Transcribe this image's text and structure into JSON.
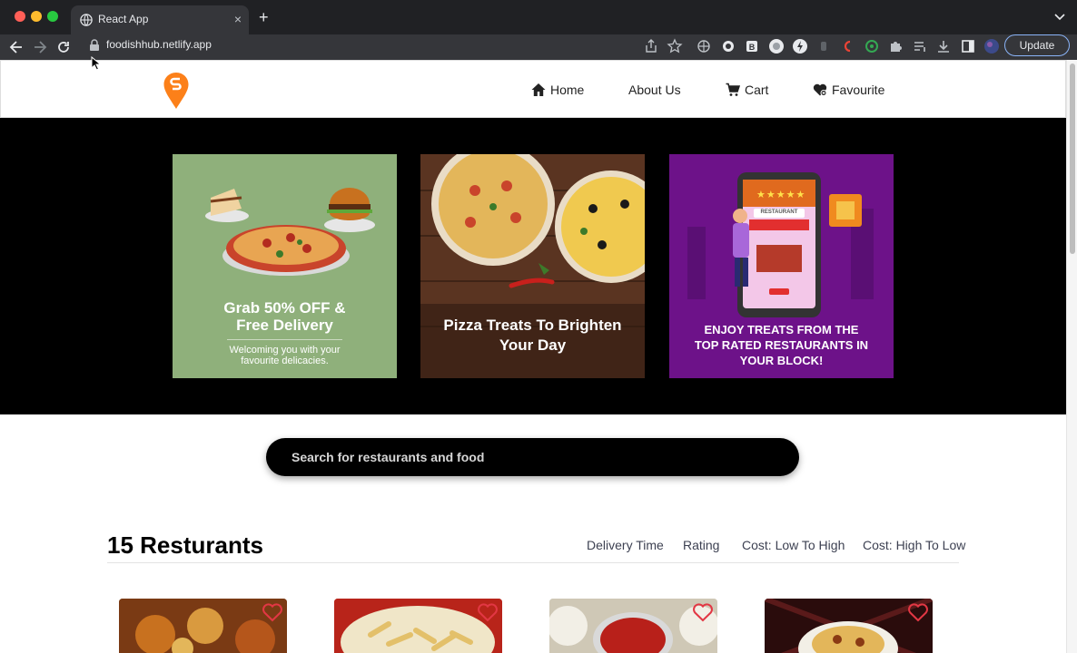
{
  "browser": {
    "tab_title": "React App",
    "tab_close": "×",
    "new_tab": "+",
    "url": "foodishhub.netlify.app",
    "update_label": "Update"
  },
  "header": {
    "nav": [
      {
        "label": "Home",
        "icon": "home-icon"
      },
      {
        "label": "About Us",
        "icon": ""
      },
      {
        "label": "Cart",
        "icon": "cart-icon"
      },
      {
        "label": "Favourite",
        "icon": "favourite-icon"
      }
    ]
  },
  "banners": [
    {
      "title": "Grab 50% OFF &",
      "title2": "Free Delivery",
      "subtitle": "Welcoming you with your",
      "subtitle2": "favourite delicacies."
    },
    {
      "title": "Pizza Treats To Brighten",
      "title2": "Your Day"
    },
    {
      "title": "ENJOY TREATS FROM THE",
      "title2": "TOP RATED RESTAURANTS IN",
      "title3": "YOUR BLOCK!",
      "rating_stars": "★★★★★",
      "sign": "RESTAURANT"
    }
  ],
  "search": {
    "placeholder": "Search for restaurants and food"
  },
  "listing": {
    "title": "15 Resturants",
    "filters": [
      "Delivery Time",
      "Rating",
      "Cost: Low To High",
      "Cost: High To Low"
    ]
  },
  "colors": {
    "brand": "#fc8019",
    "hero_bg": "#000000",
    "banner1_bg": "#8fb07b",
    "banner2_bg": "#4a2a1a",
    "banner3_bg": "#7a1a9a",
    "heart": "#e23744"
  }
}
